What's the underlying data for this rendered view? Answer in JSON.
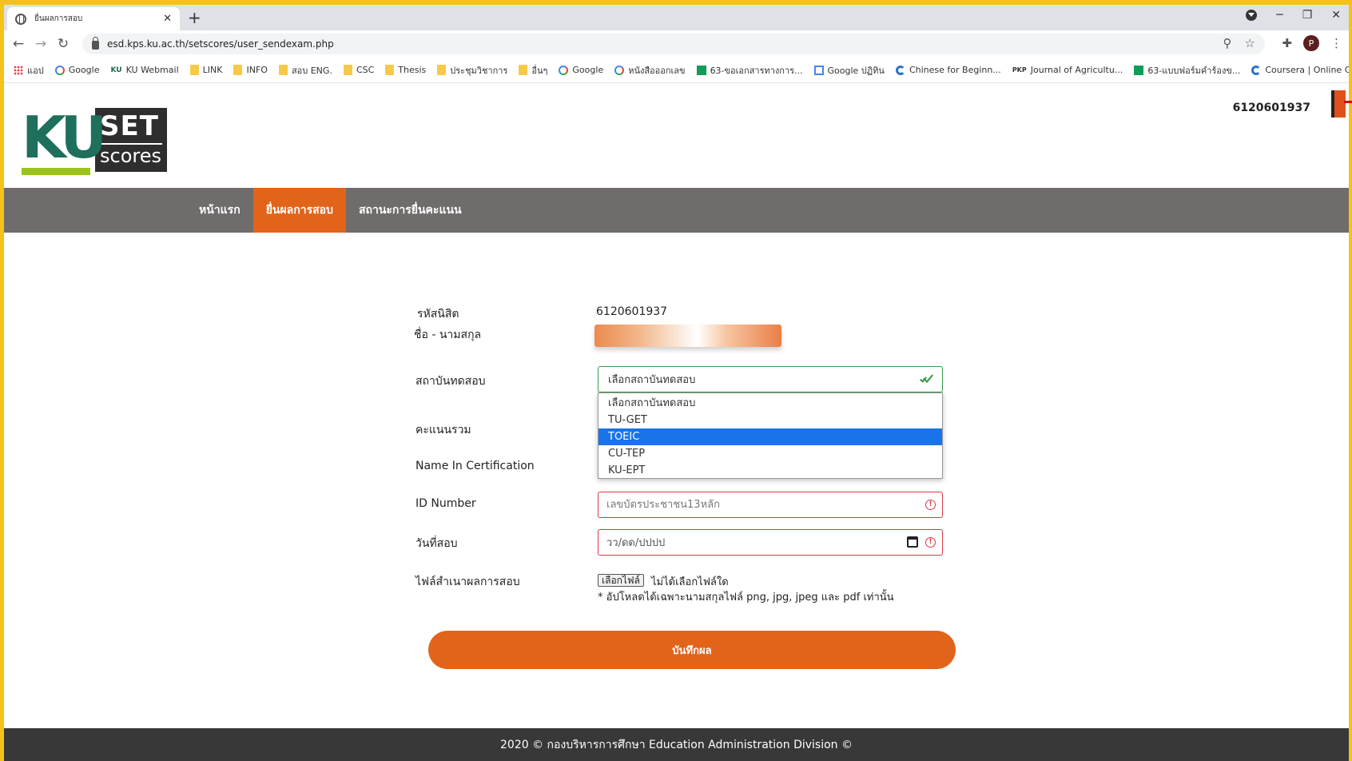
{
  "browser": {
    "tab_title": "ยื่นผลการสอบ",
    "url": "esd.kps.ku.ac.th/setscores/user_sendexam.php",
    "profile_initial": "P"
  },
  "bookmarks": [
    {
      "label": "แอป",
      "icon": "apps-icon"
    },
    {
      "label": "Google",
      "icon": "google-icon"
    },
    {
      "label": "KU Webmail",
      "icon": "ku-icon"
    },
    {
      "label": "LINK",
      "icon": "folder-icon"
    },
    {
      "label": "INFO",
      "icon": "folder-icon"
    },
    {
      "label": "สอบ ENG.",
      "icon": "folder-icon"
    },
    {
      "label": "CSC",
      "icon": "folder-icon"
    },
    {
      "label": "Thesis",
      "icon": "folder-icon"
    },
    {
      "label": "ประชุมวิชาการ",
      "icon": "folder-icon"
    },
    {
      "label": "อื่นๆ",
      "icon": "folder-icon"
    },
    {
      "label": "Google",
      "icon": "google-icon"
    },
    {
      "label": "หนังสือออกเลข",
      "icon": "google-icon"
    },
    {
      "label": "63-ขอเอกสารทางการ...",
      "icon": "sheets-icon"
    },
    {
      "label": "Google ปฏิทิน",
      "icon": "calendar-icon"
    },
    {
      "label": "Chinese for Beginn...",
      "icon": "coursera-icon"
    },
    {
      "label": "Journal of Agricultu...",
      "icon": "pkp-icon"
    },
    {
      "label": "63-แบบฟอร์มคำร้องข...",
      "icon": "sheets-icon"
    },
    {
      "label": "Coursera | Online C...",
      "icon": "coursera-icon"
    }
  ],
  "header": {
    "logo_ku": "KU",
    "logo_set": "SET",
    "logo_scores": "scores",
    "user_id": "6120601937"
  },
  "nav": {
    "home": "หน้าแรก",
    "submit": "ยื่นผลการสอบ",
    "status": "สถานะการยื่นคะแนน"
  },
  "form": {
    "student_id_label": "รหัสนิสิต",
    "student_id_value": "6120601937",
    "name_label": "ชื่อ - นามสกุล",
    "institute_label": "สถาบันทดสอบ",
    "institute_selected": "เลือกสถาบันทดสอบ",
    "institute_options": [
      "เลือกสถาบันทดสอบ",
      "TU-GET",
      "TOEIC",
      "CU-TEP",
      "KU-EPT"
    ],
    "highlighted_option": "TOEIC",
    "total_score_label": "คะแนนรวม",
    "cert_name_label": "Name In Certification",
    "id_number_label": "ID Number",
    "id_number_placeholder": "เลขบัตรประชาชน13หลัก",
    "exam_date_label": "วันที่สอบ",
    "exam_date_placeholder": "วว/ดด/ปปปป",
    "file_label": "ไฟล์สำเนาผลการสอบ",
    "file_button": "เลือกไฟล์",
    "file_status": "ไม่ได้เลือกไฟล์ใด",
    "file_note": "* อัปโหลดได้เฉพาะนามสกุลไฟล์ png, jpg, jpeg และ pdf เท่านั้น",
    "save_button": "บันทึกผล"
  },
  "footer": {
    "text": "2020 © กองบริหารการศึกษา Education Administration Division ©"
  },
  "colors": {
    "accent": "#e2641b",
    "nav_bg": "#716c6c",
    "footer_bg": "#383838",
    "valid": "#3a9b4b",
    "invalid": "#dc3545",
    "option_highlight": "#1a73e8"
  }
}
